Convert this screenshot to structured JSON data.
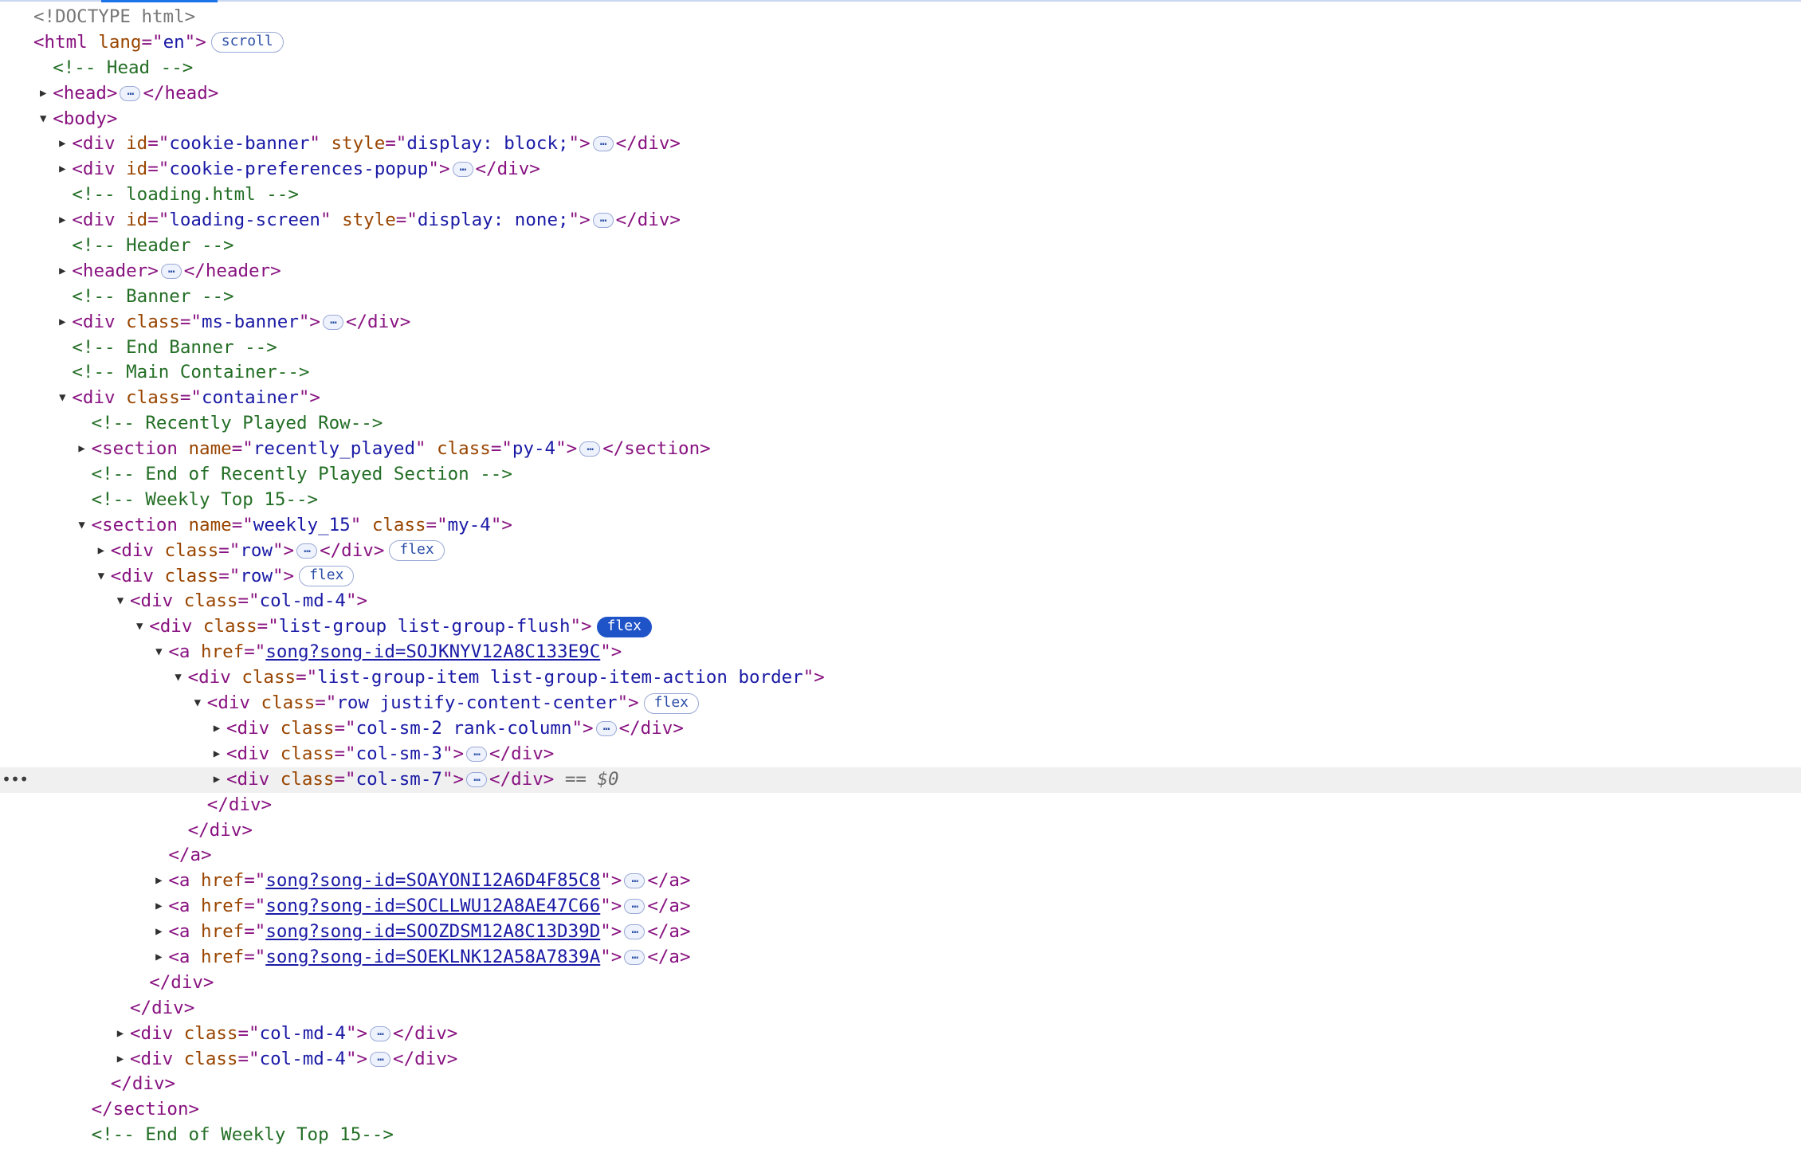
{
  "lines": [
    {
      "indent": 0,
      "tri": "none",
      "parts": [
        {
          "t": "doctype",
          "v": "<!DOCTYPE html>"
        }
      ]
    },
    {
      "indent": 0,
      "tri": "none",
      "parts": [
        {
          "t": "tag",
          "v": "<html "
        },
        {
          "t": "attr-name",
          "v": "lang"
        },
        {
          "t": "tag",
          "v": "=\""
        },
        {
          "t": "attr-value",
          "v": "en"
        },
        {
          "t": "tag",
          "v": "\">"
        },
        {
          "t": "badge",
          "v": "scroll"
        }
      ]
    },
    {
      "indent": 1,
      "tri": "none",
      "parts": [
        {
          "t": "comment",
          "v": "<!-- Head -->"
        }
      ]
    },
    {
      "indent": 1,
      "tri": "closed",
      "parts": [
        {
          "t": "tag",
          "v": "<head>"
        },
        {
          "t": "ellipsis",
          "v": "…"
        },
        {
          "t": "tag",
          "v": "</head>"
        }
      ]
    },
    {
      "indent": 1,
      "tri": "open",
      "parts": [
        {
          "t": "tag",
          "v": "<body>"
        }
      ]
    },
    {
      "indent": 2,
      "tri": "closed",
      "parts": [
        {
          "t": "tag",
          "v": "<div "
        },
        {
          "t": "attr-name",
          "v": "id"
        },
        {
          "t": "tag",
          "v": "=\""
        },
        {
          "t": "attr-value",
          "v": "cookie-banner"
        },
        {
          "t": "tag",
          "v": "\" "
        },
        {
          "t": "attr-name",
          "v": "style"
        },
        {
          "t": "tag",
          "v": "=\""
        },
        {
          "t": "attr-value",
          "v": "display: block;"
        },
        {
          "t": "tag",
          "v": "\">"
        },
        {
          "t": "ellipsis",
          "v": "…"
        },
        {
          "t": "tag",
          "v": "</div>"
        }
      ]
    },
    {
      "indent": 2,
      "tri": "closed",
      "parts": [
        {
          "t": "tag",
          "v": "<div "
        },
        {
          "t": "attr-name",
          "v": "id"
        },
        {
          "t": "tag",
          "v": "=\""
        },
        {
          "t": "attr-value",
          "v": "cookie-preferences-popup"
        },
        {
          "t": "tag",
          "v": "\">"
        },
        {
          "t": "ellipsis",
          "v": "…"
        },
        {
          "t": "tag",
          "v": "</div>"
        }
      ]
    },
    {
      "indent": 2,
      "tri": "none",
      "parts": [
        {
          "t": "comment",
          "v": "<!-- loading.html -->"
        }
      ]
    },
    {
      "indent": 2,
      "tri": "closed",
      "parts": [
        {
          "t": "tag",
          "v": "<div "
        },
        {
          "t": "attr-name",
          "v": "id"
        },
        {
          "t": "tag",
          "v": "=\""
        },
        {
          "t": "attr-value",
          "v": "loading-screen"
        },
        {
          "t": "tag",
          "v": "\" "
        },
        {
          "t": "attr-name",
          "v": "style"
        },
        {
          "t": "tag",
          "v": "=\""
        },
        {
          "t": "attr-value",
          "v": "display: none;"
        },
        {
          "t": "tag",
          "v": "\">"
        },
        {
          "t": "ellipsis",
          "v": "…"
        },
        {
          "t": "tag",
          "v": "</div>"
        }
      ]
    },
    {
      "indent": 2,
      "tri": "none",
      "parts": [
        {
          "t": "comment",
          "v": "<!-- Header -->"
        }
      ]
    },
    {
      "indent": 2,
      "tri": "closed",
      "parts": [
        {
          "t": "tag",
          "v": "<header>"
        },
        {
          "t": "ellipsis",
          "v": "…"
        },
        {
          "t": "tag",
          "v": "</header>"
        }
      ]
    },
    {
      "indent": 2,
      "tri": "none",
      "parts": [
        {
          "t": "comment",
          "v": "<!-- Banner -->"
        }
      ]
    },
    {
      "indent": 2,
      "tri": "closed",
      "parts": [
        {
          "t": "tag",
          "v": "<div "
        },
        {
          "t": "attr-name",
          "v": "class"
        },
        {
          "t": "tag",
          "v": "=\""
        },
        {
          "t": "attr-value",
          "v": "ms-banner"
        },
        {
          "t": "tag",
          "v": "\">"
        },
        {
          "t": "ellipsis",
          "v": "…"
        },
        {
          "t": "tag",
          "v": "</div>"
        }
      ]
    },
    {
      "indent": 2,
      "tri": "none",
      "parts": [
        {
          "t": "comment",
          "v": "<!-- End Banner -->"
        }
      ]
    },
    {
      "indent": 2,
      "tri": "none",
      "parts": [
        {
          "t": "comment",
          "v": "<!-- Main Container-->"
        }
      ]
    },
    {
      "indent": 2,
      "tri": "open",
      "parts": [
        {
          "t": "tag",
          "v": "<div "
        },
        {
          "t": "attr-name",
          "v": "class"
        },
        {
          "t": "tag",
          "v": "=\""
        },
        {
          "t": "attr-value",
          "v": "container"
        },
        {
          "t": "tag",
          "v": "\">"
        }
      ]
    },
    {
      "indent": 3,
      "tri": "none",
      "parts": [
        {
          "t": "comment",
          "v": "<!-- Recently Played Row-->"
        }
      ]
    },
    {
      "indent": 3,
      "tri": "closed",
      "parts": [
        {
          "t": "tag",
          "v": "<section "
        },
        {
          "t": "attr-name",
          "v": "name"
        },
        {
          "t": "tag",
          "v": "=\""
        },
        {
          "t": "attr-value",
          "v": "recently_played"
        },
        {
          "t": "tag",
          "v": "\" "
        },
        {
          "t": "attr-name",
          "v": "class"
        },
        {
          "t": "tag",
          "v": "=\""
        },
        {
          "t": "attr-value",
          "v": "py-4"
        },
        {
          "t": "tag",
          "v": "\">"
        },
        {
          "t": "ellipsis",
          "v": "…"
        },
        {
          "t": "tag",
          "v": "</section>"
        }
      ]
    },
    {
      "indent": 3,
      "tri": "none",
      "parts": [
        {
          "t": "comment",
          "v": "<!-- End of Recently Played Section -->"
        }
      ]
    },
    {
      "indent": 3,
      "tri": "none",
      "parts": [
        {
          "t": "comment",
          "v": "<!-- Weekly Top 15-->"
        }
      ]
    },
    {
      "indent": 3,
      "tri": "open",
      "parts": [
        {
          "t": "tag",
          "v": "<section "
        },
        {
          "t": "attr-name",
          "v": "name"
        },
        {
          "t": "tag",
          "v": "=\""
        },
        {
          "t": "attr-value",
          "v": "weekly_15"
        },
        {
          "t": "tag",
          "v": "\" "
        },
        {
          "t": "attr-name",
          "v": "class"
        },
        {
          "t": "tag",
          "v": "=\""
        },
        {
          "t": "attr-value",
          "v": "my-4"
        },
        {
          "t": "tag",
          "v": "\">"
        }
      ]
    },
    {
      "indent": 4,
      "tri": "closed",
      "parts": [
        {
          "t": "tag",
          "v": "<div "
        },
        {
          "t": "attr-name",
          "v": "class"
        },
        {
          "t": "tag",
          "v": "=\""
        },
        {
          "t": "attr-value",
          "v": "row"
        },
        {
          "t": "tag",
          "v": "\">"
        },
        {
          "t": "ellipsis",
          "v": "…"
        },
        {
          "t": "tag",
          "v": "</div>"
        },
        {
          "t": "badge",
          "v": "flex"
        }
      ]
    },
    {
      "indent": 4,
      "tri": "open",
      "parts": [
        {
          "t": "tag",
          "v": "<div "
        },
        {
          "t": "attr-name",
          "v": "class"
        },
        {
          "t": "tag",
          "v": "=\""
        },
        {
          "t": "attr-value",
          "v": "row"
        },
        {
          "t": "tag",
          "v": "\">"
        },
        {
          "t": "badge",
          "v": "flex"
        }
      ]
    },
    {
      "indent": 5,
      "tri": "open",
      "parts": [
        {
          "t": "tag",
          "v": "<div "
        },
        {
          "t": "attr-name",
          "v": "class"
        },
        {
          "t": "tag",
          "v": "=\""
        },
        {
          "t": "attr-value",
          "v": "col-md-4"
        },
        {
          "t": "tag",
          "v": "\">"
        }
      ]
    },
    {
      "indent": 6,
      "tri": "open",
      "parts": [
        {
          "t": "tag",
          "v": "<div "
        },
        {
          "t": "attr-name",
          "v": "class"
        },
        {
          "t": "tag",
          "v": "=\""
        },
        {
          "t": "attr-value",
          "v": "list-group list-group-flush"
        },
        {
          "t": "tag",
          "v": "\">"
        },
        {
          "t": "badge-active",
          "v": "flex"
        }
      ]
    },
    {
      "indent": 7,
      "tri": "open",
      "parts": [
        {
          "t": "tag",
          "v": "<a "
        },
        {
          "t": "attr-name",
          "v": "href"
        },
        {
          "t": "tag",
          "v": "=\""
        },
        {
          "t": "attr-link",
          "v": "song?song-id=SOJKNYV12A8C133E9C"
        },
        {
          "t": "tag",
          "v": "\">"
        }
      ]
    },
    {
      "indent": 8,
      "tri": "open",
      "parts": [
        {
          "t": "tag",
          "v": "<div "
        },
        {
          "t": "attr-name",
          "v": "class"
        },
        {
          "t": "tag",
          "v": "=\""
        },
        {
          "t": "attr-value",
          "v": "list-group-item list-group-item-action border"
        },
        {
          "t": "tag",
          "v": "\">"
        }
      ]
    },
    {
      "indent": 9,
      "tri": "open",
      "parts": [
        {
          "t": "tag",
          "v": "<div "
        },
        {
          "t": "attr-name",
          "v": "class"
        },
        {
          "t": "tag",
          "v": "=\""
        },
        {
          "t": "attr-value",
          "v": "row justify-content-center"
        },
        {
          "t": "tag",
          "v": "\">"
        },
        {
          "t": "badge",
          "v": "flex"
        }
      ]
    },
    {
      "indent": 10,
      "tri": "closed",
      "parts": [
        {
          "t": "tag",
          "v": "<div "
        },
        {
          "t": "attr-name",
          "v": "class"
        },
        {
          "t": "tag",
          "v": "=\""
        },
        {
          "t": "attr-value",
          "v": "col-sm-2 rank-column"
        },
        {
          "t": "tag",
          "v": "\">"
        },
        {
          "t": "ellipsis",
          "v": "…"
        },
        {
          "t": "tag",
          "v": "</div>"
        }
      ]
    },
    {
      "indent": 10,
      "tri": "closed",
      "parts": [
        {
          "t": "tag",
          "v": "<div "
        },
        {
          "t": "attr-name",
          "v": "class"
        },
        {
          "t": "tag",
          "v": "=\""
        },
        {
          "t": "attr-value",
          "v": "col-sm-3"
        },
        {
          "t": "tag",
          "v": "\">"
        },
        {
          "t": "ellipsis",
          "v": "…"
        },
        {
          "t": "tag",
          "v": "</div>"
        }
      ]
    },
    {
      "indent": 10,
      "tri": "closed",
      "selected": true,
      "parts": [
        {
          "t": "tag",
          "v": "<div "
        },
        {
          "t": "attr-name",
          "v": "class"
        },
        {
          "t": "tag",
          "v": "=\""
        },
        {
          "t": "attr-value",
          "v": "col-sm-7"
        },
        {
          "t": "tag",
          "v": "\">"
        },
        {
          "t": "ellipsis",
          "v": "…"
        },
        {
          "t": "tag",
          "v": "</div>"
        },
        {
          "t": "dollar",
          "v": " == $0"
        }
      ]
    },
    {
      "indent": 9,
      "tri": "none",
      "parts": [
        {
          "t": "tag",
          "v": "</div>"
        }
      ]
    },
    {
      "indent": 8,
      "tri": "none",
      "parts": [
        {
          "t": "tag",
          "v": "</div>"
        }
      ]
    },
    {
      "indent": 7,
      "tri": "none",
      "parts": [
        {
          "t": "tag",
          "v": "</a>"
        }
      ]
    },
    {
      "indent": 7,
      "tri": "closed",
      "parts": [
        {
          "t": "tag",
          "v": "<a "
        },
        {
          "t": "attr-name",
          "v": "href"
        },
        {
          "t": "tag",
          "v": "=\""
        },
        {
          "t": "attr-link",
          "v": "song?song-id=SOAYONI12A6D4F85C8"
        },
        {
          "t": "tag",
          "v": "\">"
        },
        {
          "t": "ellipsis",
          "v": "…"
        },
        {
          "t": "tag",
          "v": "</a>"
        }
      ]
    },
    {
      "indent": 7,
      "tri": "closed",
      "parts": [
        {
          "t": "tag",
          "v": "<a "
        },
        {
          "t": "attr-name",
          "v": "href"
        },
        {
          "t": "tag",
          "v": "=\""
        },
        {
          "t": "attr-link",
          "v": "song?song-id=SOCLLWU12A8AE47C66"
        },
        {
          "t": "tag",
          "v": "\">"
        },
        {
          "t": "ellipsis",
          "v": "…"
        },
        {
          "t": "tag",
          "v": "</a>"
        }
      ]
    },
    {
      "indent": 7,
      "tri": "closed",
      "parts": [
        {
          "t": "tag",
          "v": "<a "
        },
        {
          "t": "attr-name",
          "v": "href"
        },
        {
          "t": "tag",
          "v": "=\""
        },
        {
          "t": "attr-link",
          "v": "song?song-id=SOOZDSM12A8C13D39D"
        },
        {
          "t": "tag",
          "v": "\">"
        },
        {
          "t": "ellipsis",
          "v": "…"
        },
        {
          "t": "tag",
          "v": "</a>"
        }
      ]
    },
    {
      "indent": 7,
      "tri": "closed",
      "parts": [
        {
          "t": "tag",
          "v": "<a "
        },
        {
          "t": "attr-name",
          "v": "href"
        },
        {
          "t": "tag",
          "v": "=\""
        },
        {
          "t": "attr-link",
          "v": "song?song-id=SOEKLNK12A58A7839A"
        },
        {
          "t": "tag",
          "v": "\">"
        },
        {
          "t": "ellipsis",
          "v": "…"
        },
        {
          "t": "tag",
          "v": "</a>"
        }
      ]
    },
    {
      "indent": 6,
      "tri": "none",
      "parts": [
        {
          "t": "tag",
          "v": "</div>"
        }
      ]
    },
    {
      "indent": 5,
      "tri": "none",
      "parts": [
        {
          "t": "tag",
          "v": "</div>"
        }
      ]
    },
    {
      "indent": 5,
      "tri": "closed",
      "parts": [
        {
          "t": "tag",
          "v": "<div "
        },
        {
          "t": "attr-name",
          "v": "class"
        },
        {
          "t": "tag",
          "v": "=\""
        },
        {
          "t": "attr-value",
          "v": "col-md-4"
        },
        {
          "t": "tag",
          "v": "\">"
        },
        {
          "t": "ellipsis",
          "v": "…"
        },
        {
          "t": "tag",
          "v": "</div>"
        }
      ]
    },
    {
      "indent": 5,
      "tri": "closed",
      "parts": [
        {
          "t": "tag",
          "v": "<div "
        },
        {
          "t": "attr-name",
          "v": "class"
        },
        {
          "t": "tag",
          "v": "=\""
        },
        {
          "t": "attr-value",
          "v": "col-md-4"
        },
        {
          "t": "tag",
          "v": "\">"
        },
        {
          "t": "ellipsis",
          "v": "…"
        },
        {
          "t": "tag",
          "v": "</div>"
        }
      ]
    },
    {
      "indent": 4,
      "tri": "none",
      "parts": [
        {
          "t": "tag",
          "v": "</div>"
        }
      ]
    },
    {
      "indent": 3,
      "tri": "none",
      "parts": [
        {
          "t": "tag",
          "v": "</section>"
        }
      ]
    },
    {
      "indent": 3,
      "tri": "none",
      "parts": [
        {
          "t": "comment",
          "v": "<!-- End of Weekly Top 15-->"
        }
      ]
    }
  ],
  "selected_gutter": "•••"
}
